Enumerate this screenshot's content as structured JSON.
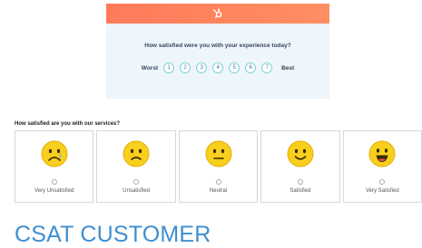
{
  "survey_card": {
    "logo_icon": "hubspot-sprocket-icon",
    "header_color": "#ff7a59",
    "question": "How satisfied were you with your experience today?",
    "low_label": "Worst",
    "high_label": "Best",
    "scale": [
      "1",
      "2",
      "3",
      "4",
      "5",
      "6",
      "7"
    ]
  },
  "services": {
    "question": "How satisfied are you with our services?",
    "options": [
      {
        "label": "Very Unsatisfied",
        "icon": "crying-face-icon"
      },
      {
        "label": "Unsatisfied",
        "icon": "frowning-face-icon"
      },
      {
        "label": "Neutral",
        "icon": "neutral-face-icon"
      },
      {
        "label": "Satisfied",
        "icon": "smiling-face-icon"
      },
      {
        "label": "Very Satisfied",
        "icon": "grinning-face-icon"
      }
    ]
  },
  "caption": "CSAT CUSTOMER"
}
